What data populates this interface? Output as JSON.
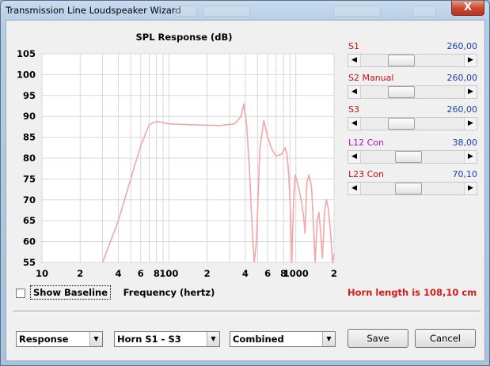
{
  "window": {
    "title": "Transmission Line Loudspeaker Wizard",
    "close_label": "X"
  },
  "chart_data": {
    "type": "line",
    "title": "SPL Response (dB)",
    "xlabel": "Frequency (hertz)",
    "ylabel": "",
    "xscale": "log",
    "xlim": [
      10,
      2000
    ],
    "ylim": [
      55,
      105
    ],
    "yticks": [
      55,
      60,
      65,
      70,
      75,
      80,
      85,
      90,
      95,
      100,
      105
    ],
    "xtick_labels": [
      {
        "v": 10,
        "t": "10"
      },
      {
        "v": 20,
        "t": "2"
      },
      {
        "v": 40,
        "t": "4"
      },
      {
        "v": 60,
        "t": "6"
      },
      {
        "v": 80,
        "t": "8"
      },
      {
        "v": 100,
        "t": "100"
      },
      {
        "v": 200,
        "t": "2"
      },
      {
        "v": 400,
        "t": "4"
      },
      {
        "v": 600,
        "t": "6"
      },
      {
        "v": 800,
        "t": "8"
      },
      {
        "v": 1000,
        "t": "1000"
      },
      {
        "v": 2000,
        "t": "2"
      }
    ],
    "grid": true,
    "color": "#f4a6a6",
    "series": [
      {
        "points": [
          [
            30,
            55
          ],
          [
            40,
            65
          ],
          [
            50,
            75
          ],
          [
            60,
            83
          ],
          [
            70,
            88
          ],
          [
            80,
            88.8
          ],
          [
            100,
            88.2
          ],
          [
            150,
            88
          ],
          [
            250,
            87.8
          ],
          [
            330,
            88.2
          ],
          [
            370,
            90
          ],
          [
            390,
            93
          ],
          [
            410,
            88
          ],
          [
            430,
            78
          ],
          [
            450,
            65
          ],
          [
            470,
            55
          ],
          [
            490,
            60
          ],
          [
            520,
            82
          ],
          [
            560,
            89
          ],
          [
            600,
            85
          ],
          [
            650,
            82
          ],
          [
            700,
            80.5
          ],
          [
            780,
            81
          ],
          [
            820,
            82.5
          ],
          [
            850,
            81
          ],
          [
            880,
            76
          ],
          [
            910,
            66
          ],
          [
            930,
            55
          ],
          [
            960,
            70
          ],
          [
            990,
            76
          ],
          [
            1050,
            73
          ],
          [
            1100,
            70
          ],
          [
            1150,
            66
          ],
          [
            1180,
            62
          ],
          [
            1220,
            74
          ],
          [
            1270,
            76
          ],
          [
            1330,
            73
          ],
          [
            1380,
            63
          ],
          [
            1420,
            55
          ],
          [
            1470,
            65
          ],
          [
            1520,
            67
          ],
          [
            1570,
            62
          ],
          [
            1620,
            56
          ],
          [
            1680,
            67
          ],
          [
            1740,
            70
          ],
          [
            1800,
            68
          ],
          [
            1880,
            62
          ],
          [
            1940,
            55
          ],
          [
            2000,
            57
          ]
        ]
      }
    ]
  },
  "sliders": [
    {
      "label": "S1",
      "value": "260,00",
      "color": "#cc1111",
      "position": 0.35
    },
    {
      "label": "S2 Manual",
      "value": "260,00",
      "color": "#cc1111",
      "position": 0.35
    },
    {
      "label": "S3",
      "value": "260,00",
      "color": "#cc1111",
      "position": 0.35
    },
    {
      "label": "L12 Con",
      "value": "38,00",
      "color": "#bb10bb",
      "position": 0.45
    },
    {
      "label": "L23 Con",
      "value": "70,10",
      "color": "#cc1111",
      "position": 0.45
    }
  ],
  "horn_length_text": "Horn length is 108,10 cm",
  "show_baseline": {
    "label": "Show Baseline",
    "checked": false
  },
  "combos": [
    {
      "value": "Response"
    },
    {
      "value": "Horn S1 - S3"
    },
    {
      "value": "Combined"
    }
  ],
  "buttons": {
    "save": "Save",
    "cancel": "Cancel"
  }
}
